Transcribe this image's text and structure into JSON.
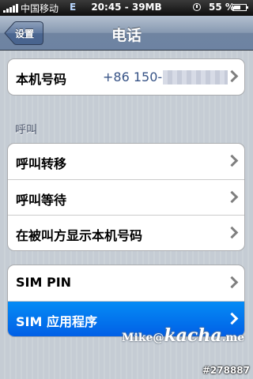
{
  "status_bar": {
    "carrier": "中国移动",
    "network": "E",
    "time_memory": "20:45 - 39MB",
    "battery_percent": "55 %",
    "battery_level": 0.55
  },
  "nav": {
    "back_label": "设置",
    "title": "电话"
  },
  "my_number": {
    "label": "本机号码",
    "value": "+86 150-"
  },
  "calling_section": {
    "header": "呼叫",
    "items": [
      {
        "label": "呼叫转移"
      },
      {
        "label": "呼叫等待"
      },
      {
        "label": "在被叫方显示本机号码"
      }
    ]
  },
  "sim_section": {
    "items": [
      {
        "label": "SIM PIN",
        "selected": false
      },
      {
        "label": "SIM 应用程序",
        "selected": true
      }
    ]
  },
  "watermark": {
    "prefix": "Mike@",
    "brand": "kacha",
    "suffix": ".me",
    "id": "#278887"
  },
  "colors": {
    "selected_row": "#0370ee",
    "nav_bar": "#6d83a2",
    "value_text": "#385487"
  }
}
